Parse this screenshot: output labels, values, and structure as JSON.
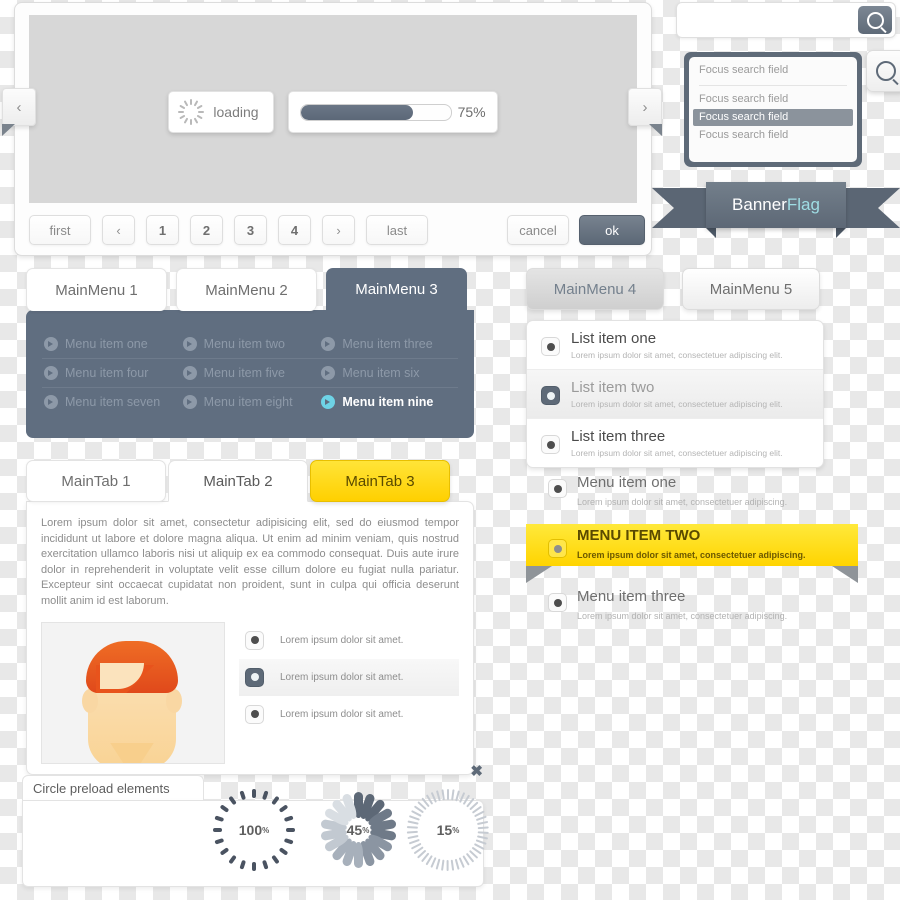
{
  "carousel": {
    "loading_label": "loading",
    "spinner_icon": "spinner-icon",
    "progress": {
      "percent": 75,
      "text": "75%"
    },
    "nav_prev": "‹",
    "nav_next": "›",
    "pagination": [
      {
        "label": "first",
        "kind": "wide"
      },
      {
        "label": "‹",
        "kind": "arrow"
      },
      {
        "label": "1",
        "kind": "num"
      },
      {
        "label": "2",
        "kind": "num"
      },
      {
        "label": "3",
        "kind": "num"
      },
      {
        "label": "4",
        "kind": "num"
      },
      {
        "label": "›",
        "kind": "arrow"
      },
      {
        "label": "last",
        "kind": "wide"
      }
    ],
    "cancel_label": "cancel",
    "ok_label": "ok"
  },
  "search": {
    "plain_placeholder": "",
    "icon": "search-icon",
    "focus_value": "Focus search field",
    "options": [
      {
        "label": "Focus search field",
        "selected": false
      },
      {
        "label": "Focus search field",
        "selected": true
      },
      {
        "label": "Focus search field",
        "selected": false
      }
    ]
  },
  "banner": {
    "text_a": "Banner",
    "text_b": "Flag",
    "color_a": "#ffffff",
    "color_b": "#9fdde4"
  },
  "main_menu": {
    "tabs": [
      {
        "label": "MainMenu 1",
        "active": false
      },
      {
        "label": "MainMenu 2",
        "active": false
      },
      {
        "label": "MainMenu 3",
        "active": true
      }
    ],
    "panel_color": "#606e80",
    "accent_color": "#6ed3e6",
    "rows": [
      [
        {
          "label": "Menu item  one",
          "active": false
        },
        {
          "label": "Menu item  two",
          "active": false
        },
        {
          "label": "Menu item  three",
          "active": false
        }
      ],
      [
        {
          "label": "Menu item  four",
          "active": false
        },
        {
          "label": "Menu item  five",
          "active": false
        },
        {
          "label": "Menu item  six",
          "active": false
        }
      ],
      [
        {
          "label": "Menu item  seven",
          "active": false
        },
        {
          "label": "Menu item  eight",
          "active": false
        },
        {
          "label": "Menu item  nine",
          "active": true
        }
      ]
    ]
  },
  "right_menu_buttons": [
    {
      "label": "MainMenu 4",
      "state": "pressed"
    },
    {
      "label": "MainMenu 5",
      "state": "normal"
    }
  ],
  "list_box": [
    {
      "title": "List item one",
      "sub": "Lorem ipsum dolor sit amet, consectetuer adipiscing elit.",
      "selected": false,
      "highlight": false
    },
    {
      "title": "List item two",
      "sub": "Lorem ipsum dolor sit amet, consectetuer adipiscing elit.",
      "selected": true,
      "highlight": true
    },
    {
      "title": "List item three",
      "sub": "Lorem ipsum dolor sit amet, consectetuer adipiscing elit.",
      "selected": false,
      "highlight": false
    }
  ],
  "right_menu_items": {
    "one": {
      "title": "Menu item one",
      "sub": "Lorem ipsum dolor sit amet, consectetuer adipiscing."
    },
    "two": {
      "title": "MENU ITEM TWO",
      "sub": "Lorem ipsum dolor sit amet, consectetuer adipiscing.",
      "color": "#ffd400"
    },
    "three": {
      "title": "Menu item three",
      "sub": "Lorem ipsum dolor sit amet, consectetuer adipiscing."
    }
  },
  "main_tabs": {
    "tabs": [
      {
        "label": "MainTab 1",
        "state": "off"
      },
      {
        "label": "MainTab 2",
        "state": "cur"
      },
      {
        "label": "MainTab 3",
        "state": "yellow"
      }
    ],
    "paragraph": "Lorem ipsum dolor sit amet, consectetur adipisicing elit, sed do eiusmod tempor incididunt ut labore et dolore magna aliqua. Ut enim ad minim veniam, quis nostrud exercitation ullamco laboris nisi ut aliquip ex ea commodo consequat. Duis aute irure dolor in reprehenderit in voluptate velit esse cillum dolore eu fugiat nulla pariatur. Excepteur sint occaecat cupidatat non proident, sunt in culpa qui officia deserunt mollit anim id est laborum.",
    "avatar_icon": "avatar-face",
    "options": [
      {
        "label": "Lorem ipsum dolor sit amet.",
        "selected": false,
        "highlight": false
      },
      {
        "label": "Lorem ipsum dolor sit amet.",
        "selected": true,
        "highlight": true
      },
      {
        "label": "Lorem ipsum dolor sit amet.",
        "selected": false,
        "highlight": false
      }
    ],
    "close_icon": "✖"
  },
  "preloaders": {
    "title": "Circle preload elements",
    "circles": [
      {
        "value": "100",
        "unit": "%",
        "style": "dashed-ring"
      },
      {
        "value": "45",
        "unit": "%",
        "style": "petal-ring"
      },
      {
        "value": "15",
        "unit": "%",
        "style": "fine-tick-ring"
      }
    ]
  }
}
